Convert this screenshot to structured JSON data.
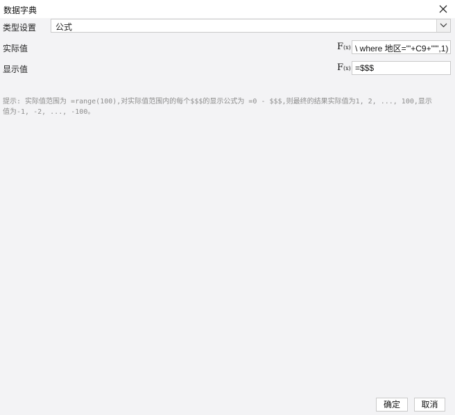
{
  "window": {
    "title": "数据字典"
  },
  "type_setting": {
    "label": "类型设置",
    "selected": "公式"
  },
  "actual_value": {
    "label": "实际值",
    "fx": "F",
    "fx_sub": "(x)",
    "value": "\\ where 地区=\"'+C9+'\"\",1)"
  },
  "display_value": {
    "label": "显示值",
    "fx": "F",
    "fx_sub": "(x)",
    "value": "=$$$"
  },
  "hint": {
    "text": "提示: 实际值范围为 =range(100),对实际值范围内的每个$$$的显示公式为 =0 - $$$,则最终的结果实际值为1, 2, ..., 100,显示值为-1, -2, ..., -100。"
  },
  "buttons": {
    "ok": "确定",
    "cancel": "取消"
  }
}
